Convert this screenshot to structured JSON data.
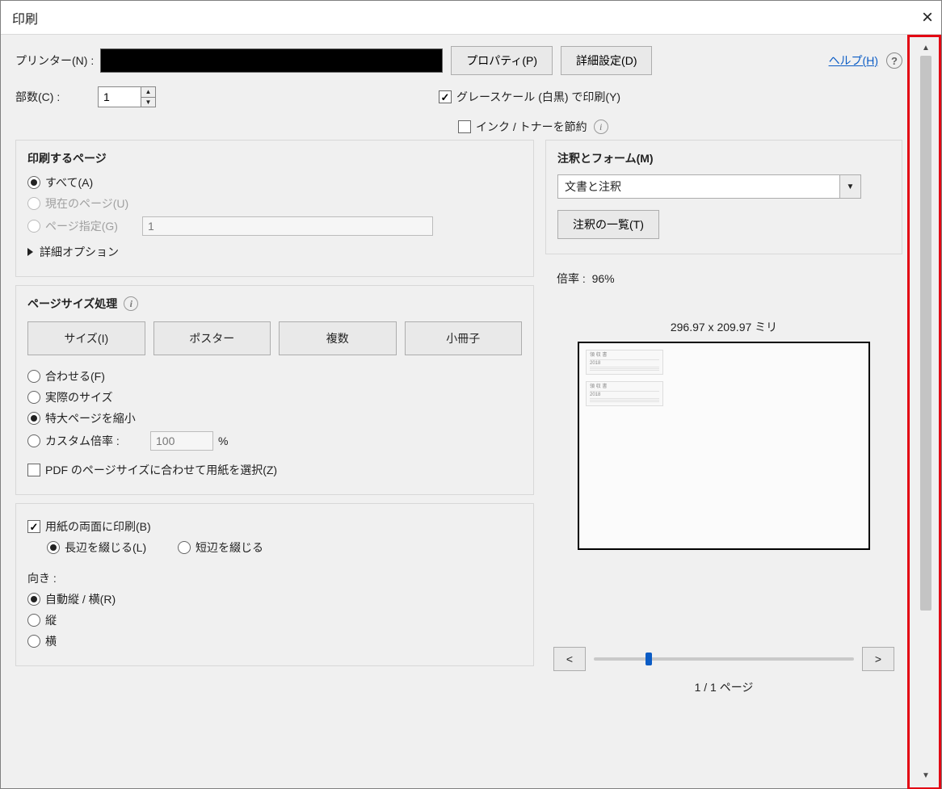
{
  "window": {
    "title": "印刷"
  },
  "top": {
    "printer_label": "プリンター(N) :",
    "properties_btn": "プロパティ(P)",
    "advanced_btn": "詳細設定(D)",
    "help_link": "ヘルプ(H)",
    "copies_label": "部数(C) :",
    "copies_value": "1",
    "grayscale_label": "グレースケール (白黒) で印刷(Y)",
    "grayscale_checked": true,
    "save_ink_label": "インク / トナーを節約",
    "save_ink_checked": false
  },
  "pages": {
    "title": "印刷するページ",
    "all": "すべて(A)",
    "current": "現在のページ(U)",
    "range_label": "ページ指定(G)",
    "range_value": "1",
    "advanced_options": "詳細オプション"
  },
  "sizing": {
    "title": "ページサイズ処理",
    "tabs": {
      "size": "サイズ(I)",
      "poster": "ポスター",
      "multi": "複数",
      "booklet": "小冊子"
    },
    "fit": "合わせる(F)",
    "actual": "実際のサイズ",
    "shrink": "特大ページを縮小",
    "custom_label": "カスタム倍率 :",
    "custom_value": "100",
    "custom_unit": "%",
    "match_pdf": "PDF のページサイズに合わせて用紙を選択(Z)"
  },
  "duplex": {
    "both": "用紙の両面に印刷(B)",
    "both_checked": true,
    "long": "長辺を綴じる(L)",
    "short": "短辺を綴じる"
  },
  "orient": {
    "label": "向き :",
    "auto": "自動縦 / 横(R)",
    "portrait": "縦",
    "landscape": "横"
  },
  "comments": {
    "title": "注釈とフォーム(M)",
    "dropdown_value": "文書と注釈",
    "summarize_btn": "注釈の一覧(T)"
  },
  "preview": {
    "zoom_label": "倍率 :",
    "zoom_value": "96%",
    "paper_dim": "296.97 x 209.97 ミリ",
    "prev": "<",
    "next": ">",
    "pager": "1 / 1 ページ"
  }
}
